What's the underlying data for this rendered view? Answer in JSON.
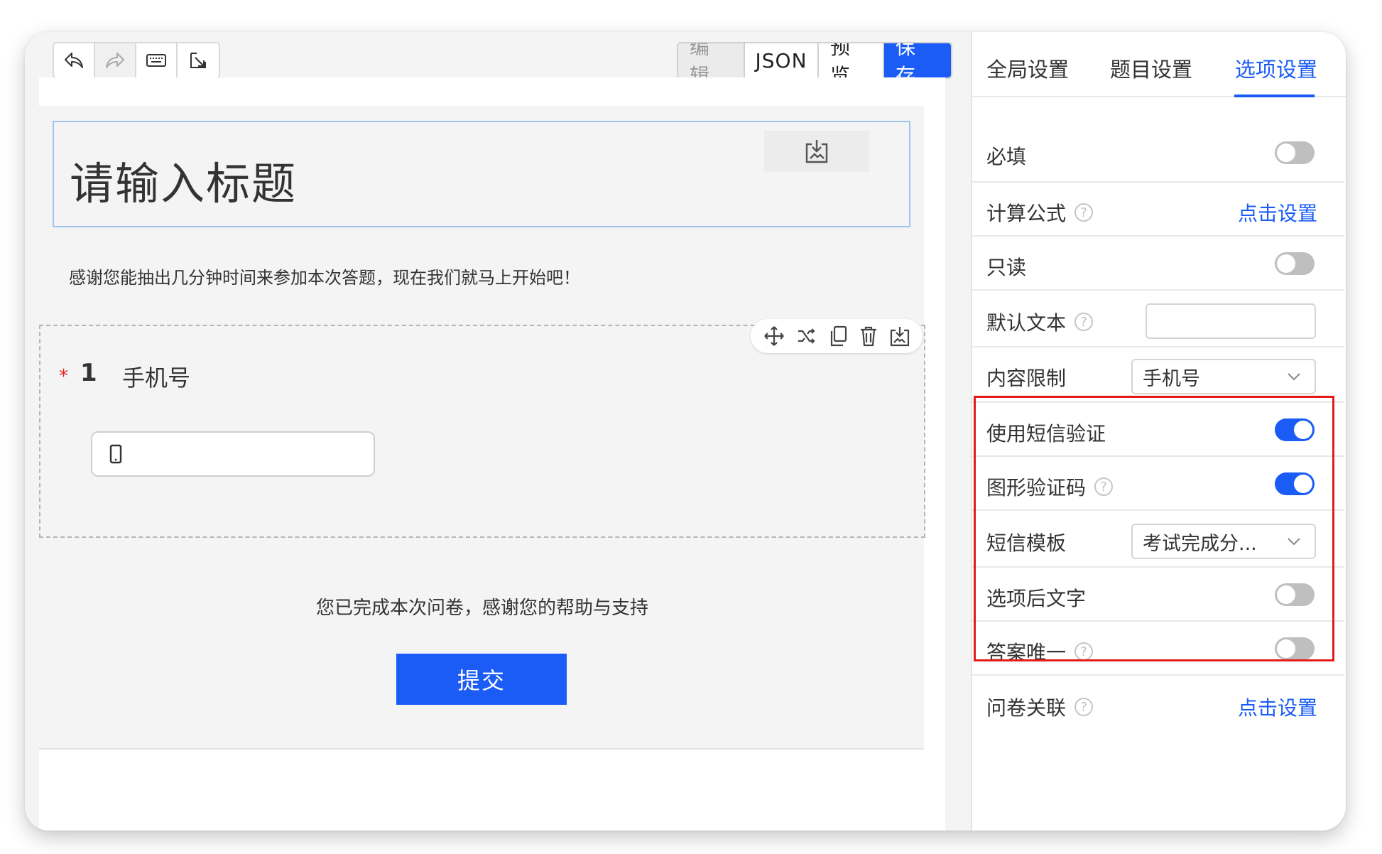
{
  "toolbar": {
    "mode_buttons": {
      "edit": "编 辑",
      "json": "JSON",
      "preview": "预 览",
      "save": "保 存"
    }
  },
  "survey": {
    "title": "请输入标题",
    "intro": "感谢您能抽出几分钟时间来参加本次答题，现在我们就马上开始吧！",
    "question": {
      "required_mark": "*",
      "number": "1",
      "label": "手机号"
    },
    "finish_text": "您已完成本次问卷，感谢您的帮助与支持",
    "submit_label": "提交"
  },
  "panel": {
    "tabs": [
      "全局设置",
      "题目设置",
      "选项设置"
    ],
    "active_tab": "选项设置",
    "rows": {
      "required": {
        "label": "必填",
        "toggle": false
      },
      "formula": {
        "label": "计算公式",
        "link": "点击设置"
      },
      "readonly": {
        "label": "只读",
        "toggle": false
      },
      "default_text": {
        "label": "默认文本",
        "value": ""
      },
      "content_limit": {
        "label": "内容限制",
        "value": "手机号"
      },
      "sms_verify": {
        "label": "使用短信验证",
        "toggle": true
      },
      "captcha": {
        "label": "图形验证码",
        "toggle": true
      },
      "sms_template": {
        "label": "短信模板",
        "value": "考试完成分..."
      },
      "after_text": {
        "label": "选项后文字",
        "toggle": false
      },
      "unique_answer": {
        "label": "答案唯一",
        "toggle": false
      },
      "survey_link": {
        "label": "问卷关联",
        "link": "点击设置"
      }
    }
  },
  "colors": {
    "accent": "#1a5cf5",
    "highlight_border": "#e31b1b",
    "required_star": "#e02020"
  }
}
